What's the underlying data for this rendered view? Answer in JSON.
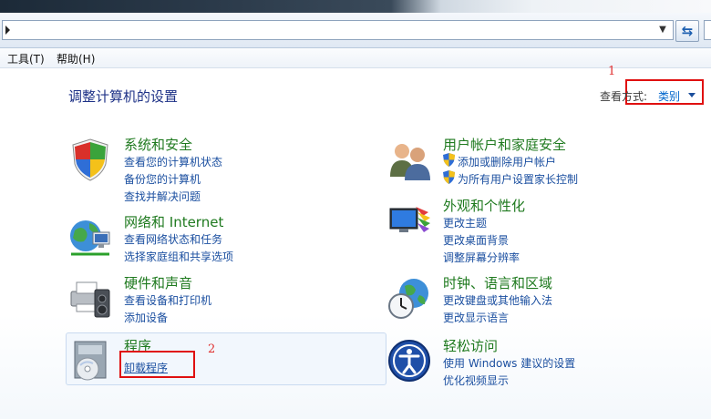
{
  "menu": {
    "tools": "工具(T)",
    "help": "帮助(H)"
  },
  "page_title": "调整计算机的设置",
  "view": {
    "label": "查看方式:",
    "value": "类别"
  },
  "annotations": {
    "one": "1",
    "two": "2"
  },
  "categories": {
    "system": {
      "title": "系统和安全",
      "icon": "shield-icon",
      "links": [
        "查看您的计算机状态",
        "备份您的计算机",
        "查找并解决问题"
      ]
    },
    "network": {
      "title": "网络和 Internet",
      "icon": "network-globe-icon",
      "links": [
        "查看网络状态和任务",
        "选择家庭组和共享选项"
      ]
    },
    "hardware": {
      "title": "硬件和声音",
      "icon": "printer-speaker-icon",
      "links": [
        "查看设备和打印机",
        "添加设备"
      ]
    },
    "programs": {
      "title": "程序",
      "icon": "programs-disc-icon",
      "links": [
        "卸载程序"
      ]
    },
    "users": {
      "title": "用户帐户和家庭安全",
      "icon": "users-icon",
      "links": [
        "添加或删除用户帐户",
        "为所有用户设置家长控制"
      ]
    },
    "appearance": {
      "title": "外观和个性化",
      "icon": "monitor-palette-icon",
      "links": [
        "更改主题",
        "更改桌面背景",
        "调整屏幕分辨率"
      ]
    },
    "clock": {
      "title": "时钟、语言和区域",
      "icon": "clock-globe-icon",
      "links": [
        "更改键盘或其他输入法",
        "更改显示语言"
      ]
    },
    "ease": {
      "title": "轻松访问",
      "icon": "ease-of-access-icon",
      "links": [
        "使用 Windows 建议的设置",
        "优化视频显示"
      ]
    }
  },
  "colors": {
    "category_title": "#1f7a1f",
    "link": "#1b4fa0",
    "page_title": "#1e3287",
    "annotation": "#e01010"
  }
}
